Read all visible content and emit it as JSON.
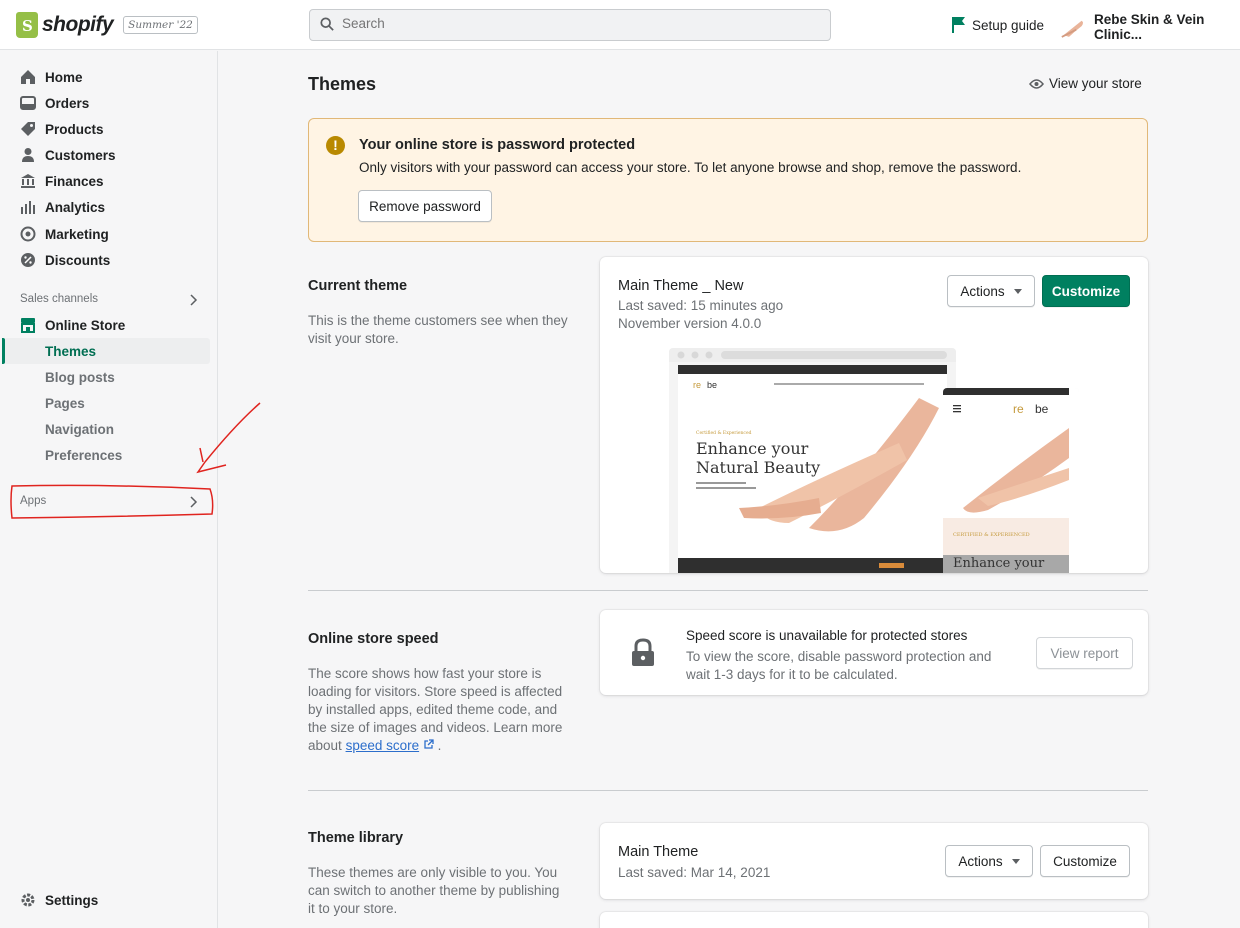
{
  "header": {
    "brand": "shopify",
    "edition": "Summer '22",
    "search_placeholder": "Search",
    "setup_guide": "Setup guide",
    "store_name": "Rebe Skin & Vein Clinic..."
  },
  "sidebar": {
    "items": [
      {
        "label": "Home",
        "icon": "home-icon"
      },
      {
        "label": "Orders",
        "icon": "orders-icon"
      },
      {
        "label": "Products",
        "icon": "tag-icon"
      },
      {
        "label": "Customers",
        "icon": "person-icon"
      },
      {
        "label": "Finances",
        "icon": "bank-icon"
      },
      {
        "label": "Analytics",
        "icon": "bar-chart-icon"
      },
      {
        "label": "Marketing",
        "icon": "target-icon"
      },
      {
        "label": "Discounts",
        "icon": "discount-icon"
      }
    ],
    "sales_channels_label": "Sales channels",
    "online_store": "Online Store",
    "sub_items": [
      "Themes",
      "Blog posts",
      "Pages",
      "Navigation",
      "Preferences"
    ],
    "apps_label": "Apps",
    "settings": "Settings"
  },
  "main": {
    "title": "Themes",
    "view_store": "View your store",
    "banner": {
      "title": "Your online store is password protected",
      "text": "Only visitors with your password can access your store. To let anyone browse and shop, remove the password.",
      "button": "Remove password"
    },
    "current_theme": {
      "heading": "Current theme",
      "description": "This is the theme customers see when they visit your store.",
      "name": "Main Theme _ New",
      "saved": "Last saved: 15 minutes ago",
      "version": "November version 4.0.0",
      "actions_label": "Actions",
      "customize_label": "Customize",
      "preview_headline_1": "Enhance your",
      "preview_headline_2": "Natural Beauty",
      "preview_mobile_kicker": "CERTIFIED & EXPERIENCED",
      "preview_mobile_headline": "Enhance your"
    },
    "speed": {
      "heading": "Online store speed",
      "description": "The score shows how fast your store is loading for visitors. Store speed is affected by installed apps, edited theme code, and the size of images and videos. Learn more about",
      "link": "speed score",
      "card_title": "Speed score is unavailable for protected stores",
      "card_text": "To view the score, disable password protection and wait 1-3 days for it to be calculated.",
      "button": "View report"
    },
    "library": {
      "heading": "Theme library",
      "description": "These themes are only visible to you. You can switch to another theme by publishing it to your store.",
      "name": "Main Theme",
      "saved": "Last saved: Mar 14, 2021",
      "actions_label": "Actions",
      "customize_label": "Customize"
    }
  },
  "colors": {
    "accent": "#008060",
    "banner_bg": "#fff4e4",
    "warning": "#b98900",
    "annotation": "#e0241f"
  }
}
